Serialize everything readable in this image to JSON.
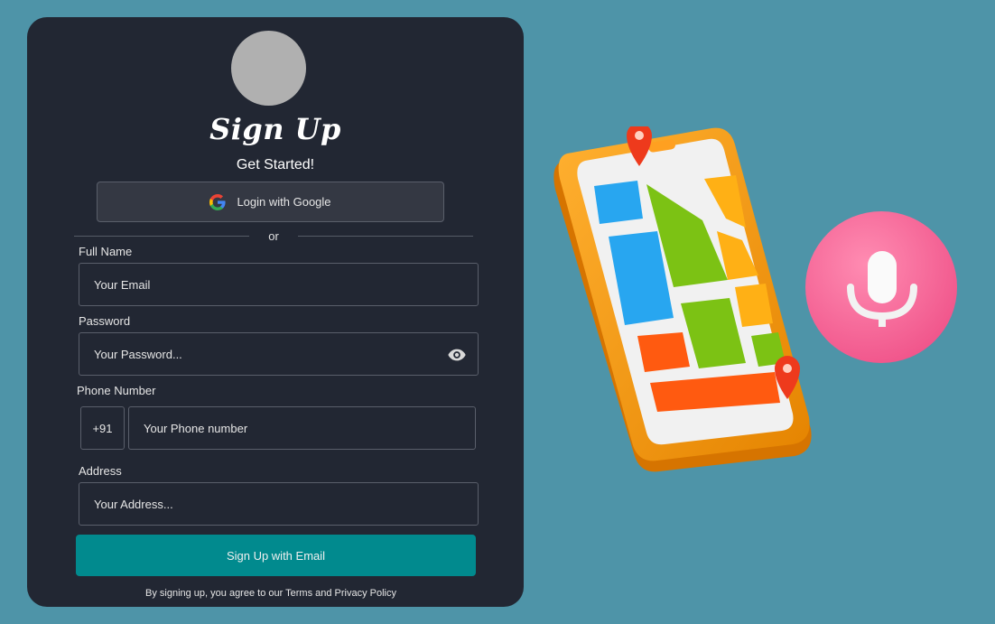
{
  "form": {
    "title": "Sign Up",
    "subtitle": "Get Started!",
    "google_button": "Login with Google",
    "divider": "or",
    "full_name": {
      "label": "Full Name",
      "placeholder": "Your Email"
    },
    "password": {
      "label": "Password",
      "placeholder": "Your Password..."
    },
    "phone": {
      "label": "Phone Number",
      "prefix": "+91",
      "placeholder": "Your Phone number"
    },
    "address": {
      "label": "Address",
      "placeholder": "Your Address..."
    },
    "submit": "Sign Up with Email",
    "terms": "By signing up, you agree to our Terms and Privacy Policy"
  },
  "colors": {
    "background": "#4e94a8",
    "card": "#222733",
    "accent": "#018a8e"
  },
  "illustration": {
    "phone": "phone-map-illustration",
    "mic": "microphone-badge-illustration"
  }
}
